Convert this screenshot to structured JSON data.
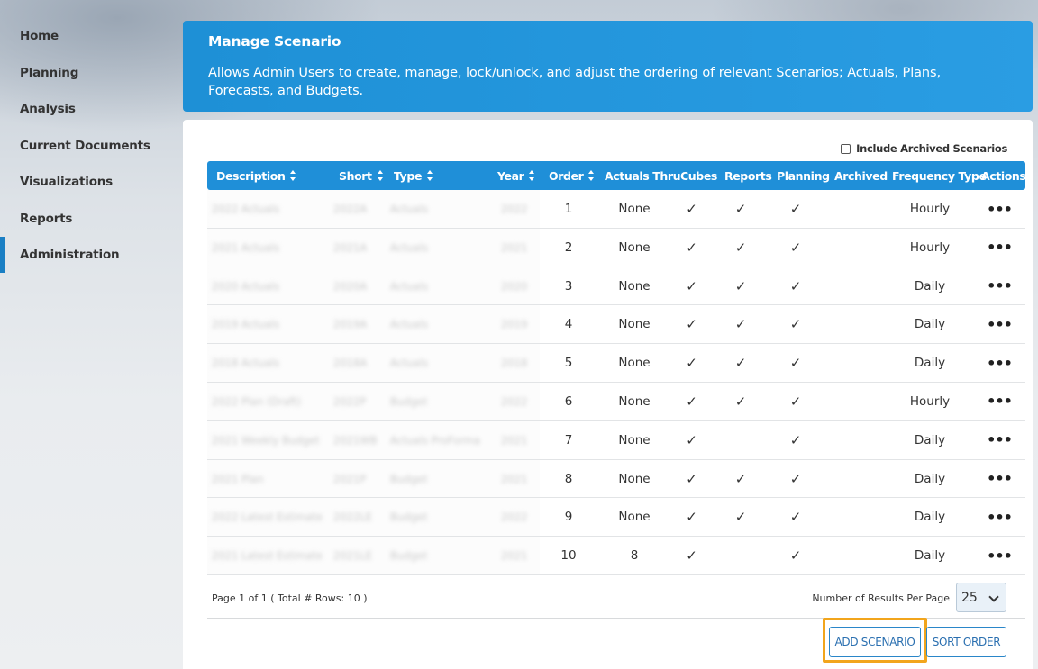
{
  "sidebar": {
    "items": [
      {
        "label": "Home",
        "active": false
      },
      {
        "label": "Planning",
        "active": false
      },
      {
        "label": "Analysis",
        "active": false
      },
      {
        "label": "Current Documents",
        "active": false
      },
      {
        "label": "Visualizations",
        "active": false
      },
      {
        "label": "Reports",
        "active": false
      },
      {
        "label": "Administration",
        "active": true
      }
    ]
  },
  "header": {
    "title": "Manage Scenario",
    "description": "Allows Admin Users to create, manage, lock/unlock, and adjust the ordering of relevant Scenarios; Actuals, Plans, Forecasts, and Budgets."
  },
  "filters": {
    "include_archived_label": "Include Archived Scenarios",
    "include_archived_checked": false
  },
  "table": {
    "columns": [
      "Description",
      "Short",
      "Type",
      "Year",
      "Order",
      "Actuals Thru",
      "Cubes",
      "Reports",
      "Planning",
      "Archived",
      "Frequency Type",
      "Actions"
    ],
    "rows": [
      {
        "description": "2022 Actuals",
        "short": "2022A",
        "type": "Actuals",
        "year": "2022",
        "order": "1",
        "actuals_thru": "None",
        "cubes": "✓",
        "reports": "✓",
        "planning": "✓",
        "archived": "",
        "frequency": "Hourly",
        "actions": "•••"
      },
      {
        "description": "2021 Actuals",
        "short": "2021A",
        "type": "Actuals",
        "year": "2021",
        "order": "2",
        "actuals_thru": "None",
        "cubes": "✓",
        "reports": "✓",
        "planning": "✓",
        "archived": "",
        "frequency": "Hourly",
        "actions": "•••"
      },
      {
        "description": "2020 Actuals",
        "short": "2020A",
        "type": "Actuals",
        "year": "2020",
        "order": "3",
        "actuals_thru": "None",
        "cubes": "✓",
        "reports": "✓",
        "planning": "✓",
        "archived": "",
        "frequency": "Daily",
        "actions": "•••"
      },
      {
        "description": "2019 Actuals",
        "short": "2019A",
        "type": "Actuals",
        "year": "2019",
        "order": "4",
        "actuals_thru": "None",
        "cubes": "✓",
        "reports": "✓",
        "planning": "✓",
        "archived": "",
        "frequency": "Daily",
        "actions": "•••"
      },
      {
        "description": "2018 Actuals",
        "short": "2018A",
        "type": "Actuals",
        "year": "2018",
        "order": "5",
        "actuals_thru": "None",
        "cubes": "✓",
        "reports": "✓",
        "planning": "✓",
        "archived": "",
        "frequency": "Daily",
        "actions": "•••"
      },
      {
        "description": "2022 Plan (Draft)",
        "short": "2022P",
        "type": "Budget",
        "year": "2022",
        "order": "6",
        "actuals_thru": "None",
        "cubes": "✓",
        "reports": "✓",
        "planning": "✓",
        "archived": "",
        "frequency": "Hourly",
        "actions": "•••"
      },
      {
        "description": "2021 Weekly Budget",
        "short": "2021WB",
        "type": "Actuals ProForma",
        "year": "2021",
        "order": "7",
        "actuals_thru": "None",
        "cubes": "✓",
        "reports": "",
        "planning": "✓",
        "archived": "",
        "frequency": "Daily",
        "actions": "•••"
      },
      {
        "description": "2021 Plan",
        "short": "2021P",
        "type": "Budget",
        "year": "2021",
        "order": "8",
        "actuals_thru": "None",
        "cubes": "✓",
        "reports": "✓",
        "planning": "✓",
        "archived": "",
        "frequency": "Daily",
        "actions": "•••"
      },
      {
        "description": "2022 Latest Estimate",
        "short": "2022LE",
        "type": "Budget",
        "year": "2022",
        "order": "9",
        "actuals_thru": "None",
        "cubes": "✓",
        "reports": "✓",
        "planning": "✓",
        "archived": "",
        "frequency": "Daily",
        "actions": "•••"
      },
      {
        "description": "2021 Latest Estimate",
        "short": "2021LE",
        "type": "Budget",
        "year": "2021",
        "order": "10",
        "actuals_thru": "8",
        "cubes": "✓",
        "reports": "",
        "planning": "✓",
        "archived": "",
        "frequency": "Daily",
        "actions": "•••"
      }
    ]
  },
  "pager": {
    "info": "Page 1 of 1 ( Total # Rows: 10 )",
    "results_per_page_label": "Number of Results Per Page",
    "results_per_page_value": "25"
  },
  "buttons": {
    "add_scenario": "ADD SCENARIO",
    "sort_order": "SORT ORDER"
  },
  "colors": {
    "accent": "#1f8fd8",
    "highlight": "#f2a51c"
  }
}
